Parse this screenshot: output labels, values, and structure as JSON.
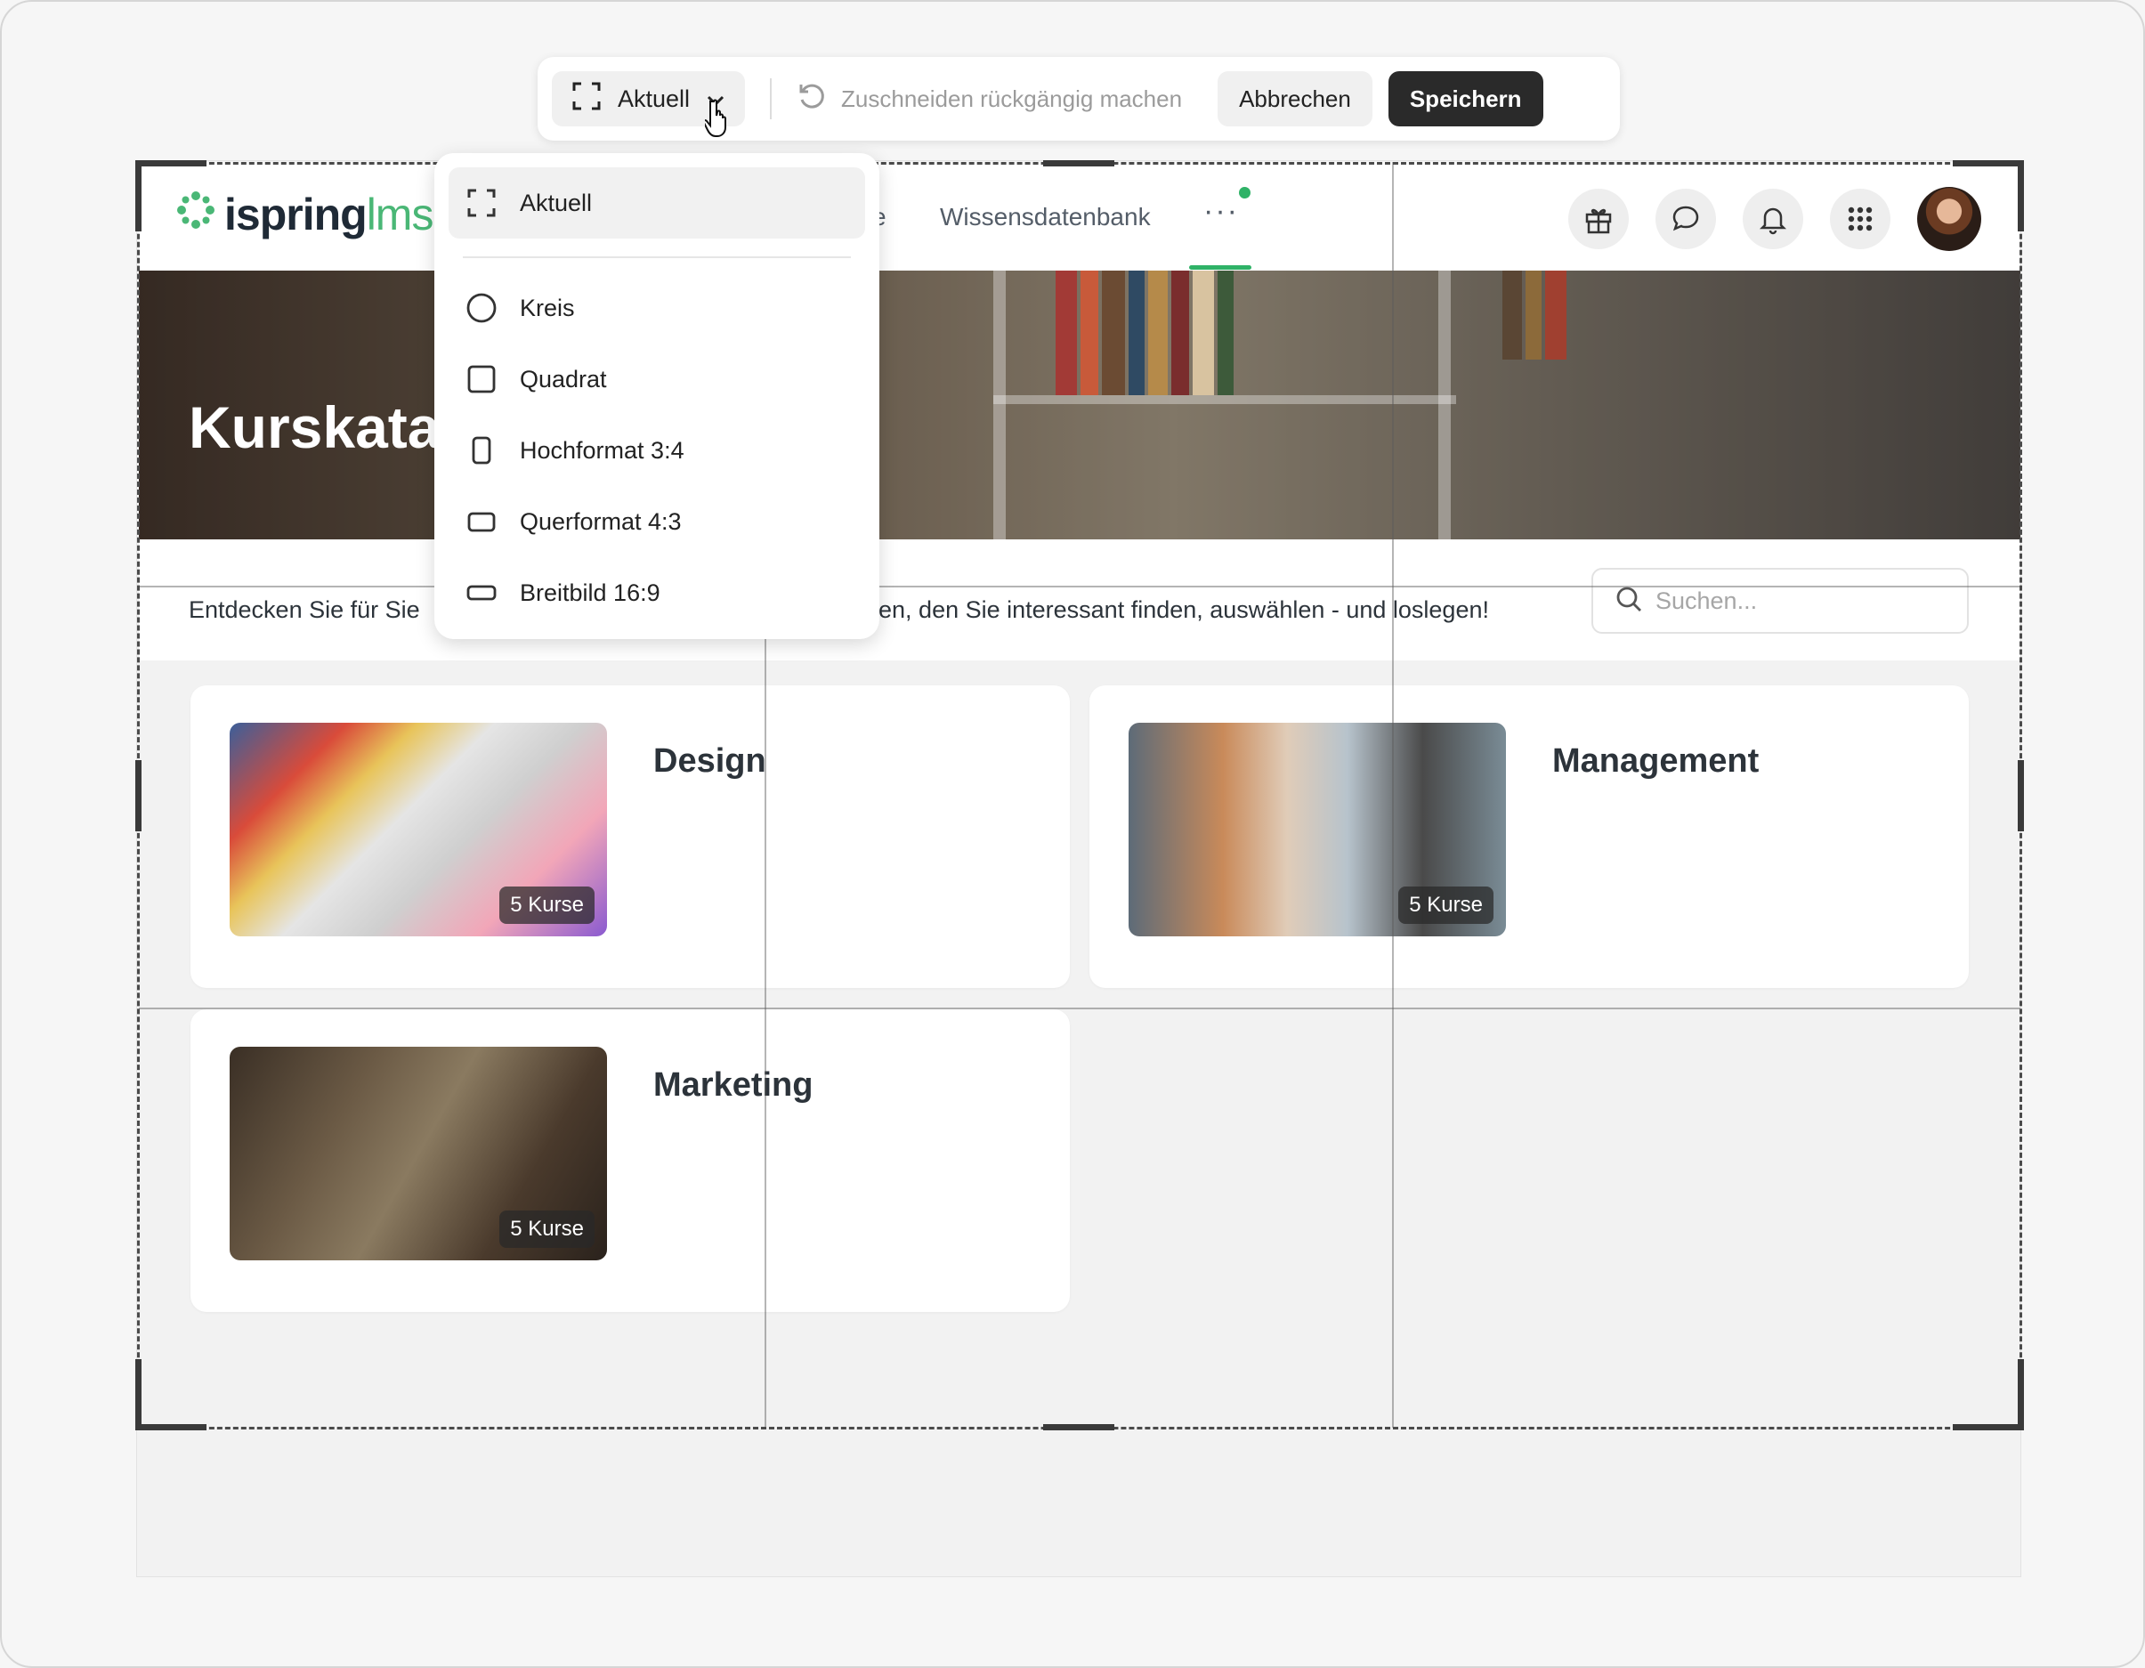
{
  "toolbar": {
    "aspect_label": "Aktuell",
    "undo_label": "Zuschneiden rückgängig machen",
    "cancel_label": "Abbrechen",
    "save_label": "Speichern"
  },
  "dropdown": {
    "items": [
      {
        "label": "Aktuell",
        "icon": "crop-frame-icon",
        "selected": true
      },
      {
        "label": "Kreis",
        "icon": "circle-icon"
      },
      {
        "label": "Quadrat",
        "icon": "square-icon"
      },
      {
        "label": "Hochformat 3:4",
        "icon": "portrait-icon"
      },
      {
        "label": "Querformat 4:3",
        "icon": "landscape-icon"
      },
      {
        "label": "Breitbild 16:9",
        "icon": "widescreen-icon"
      }
    ]
  },
  "lms": {
    "logo_main": "ispring",
    "logo_accent": "lms",
    "nav_partial": "e",
    "nav_knowledge": "Wissensdatenbank",
    "nav_more": "···",
    "banner_title": "Kurskata",
    "intro_left": "Entdecken Sie für Sie",
    "intro_right": "hen, den Sie interessant finden, auswählen - und loslegen!",
    "search_placeholder": "Suchen...",
    "cards": [
      {
        "title": "Design",
        "count": "5 Kurse"
      },
      {
        "title": "Management",
        "count": "5 Kurse"
      },
      {
        "title": "Marketing",
        "count": "5 Kurse"
      }
    ]
  },
  "colors": {
    "accent": "#2fb267",
    "save_button": "#2a2a2a",
    "logo_green": "#4ab776"
  }
}
